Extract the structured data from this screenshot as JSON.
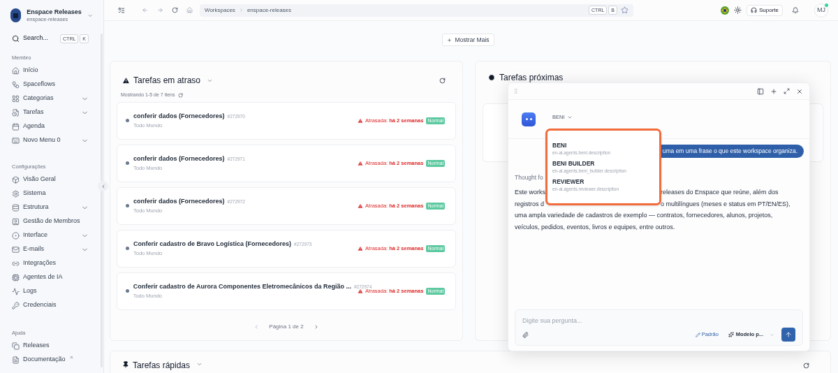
{
  "workspace": {
    "name": "Enspace Releases",
    "slug": "enspace-releases"
  },
  "search": {
    "label": "Search...",
    "keys": [
      "CTRL",
      "K"
    ]
  },
  "sidebar": {
    "sections": [
      {
        "title": "Membro",
        "items": [
          {
            "label": "Início",
            "expandable": false,
            "external": false
          },
          {
            "label": "Spaceflows",
            "expandable": false,
            "external": false
          },
          {
            "label": "Categorias",
            "expandable": true,
            "external": false
          },
          {
            "label": "Tarefas",
            "expandable": true,
            "external": false
          },
          {
            "label": "Agenda",
            "expandable": false,
            "external": false
          },
          {
            "label": "Novo Menu 0",
            "expandable": true,
            "external": false
          }
        ]
      },
      {
        "title": "Configurações",
        "items": [
          {
            "label": "Visão Geral",
            "expandable": false,
            "external": false
          },
          {
            "label": "Sistema",
            "expandable": false,
            "external": false
          },
          {
            "label": "Estrutura",
            "expandable": true,
            "external": false
          },
          {
            "label": "Gestão de Membros",
            "expandable": false,
            "external": false
          },
          {
            "label": "Interface",
            "expandable": true,
            "external": false
          },
          {
            "label": "E-mails",
            "expandable": true,
            "external": false
          },
          {
            "label": "Integrações",
            "expandable": false,
            "external": false
          },
          {
            "label": "Agentes de IA",
            "expandable": false,
            "external": false
          },
          {
            "label": "Logs",
            "expandable": false,
            "external": false
          },
          {
            "label": "Credenciais",
            "expandable": false,
            "external": false
          }
        ]
      },
      {
        "title": "Ajuda",
        "items": [
          {
            "label": "Releases",
            "expandable": false,
            "external": false
          },
          {
            "label": "Documentação",
            "expandable": false,
            "external": true
          }
        ]
      }
    ]
  },
  "toolbar": {
    "breadcrumb": [
      "Workspaces",
      "enspace-releases"
    ],
    "keys": [
      "CTRL",
      "B"
    ],
    "support": "Suporte",
    "avatar": "MJ",
    "online": true
  },
  "show_more": "Mostrar Mais",
  "overdue": {
    "title": "Tarefas em atraso",
    "summary": "Mostrando 1-5 de 7 itens",
    "pagination": "Página 1 de 2",
    "tasks": [
      {
        "title": "conferir dados (Fornecedores)",
        "id": "#272970",
        "assignee": "Todo Mundo",
        "due": "Atrasada: **há 2 semanas**",
        "priority": "Normal"
      },
      {
        "title": "conferir dados (Fornecedores)",
        "id": "#272971",
        "assignee": "Todo Mundo",
        "due": "Atrasada: **há 2 semanas**",
        "priority": "Normal"
      },
      {
        "title": "conferir dados (Fornecedores)",
        "id": "#272972",
        "assignee": "Todo Mundo",
        "due": "Atrasada: **há 2 semanas**",
        "priority": "Normal"
      },
      {
        "title": "Conferir cadastro de Bravo Logística (Fornecedores)",
        "id": "#272973",
        "assignee": "Todo Mundo",
        "due": "Atrasada: **há 2 semanas**",
        "priority": "Normal"
      },
      {
        "title": "Conferir cadastro de Aurora Componentes Eletromecânicos da Região ...",
        "id": "#272974",
        "assignee": "Todo Mundo",
        "due": "Atrasada: **há 2 semanas**",
        "priority": "Normal"
      }
    ]
  },
  "upcoming": {
    "title": "Tarefas próximas"
  },
  "quick": {
    "title": "Tarefas rápidas"
  },
  "chat": {
    "agent": "BENI",
    "agents": [
      {
        "name": "BENI",
        "description": "en-ai.agents.beni.description"
      },
      {
        "name": "BENI BUILDER",
        "description": "en-ai.agents.beni_builder.description"
      },
      {
        "name": "REVIEWER",
        "description": "en-ai.agents.reviewer.description"
      }
    ],
    "user_message": "uma em uma frase o que este workspace organiza.",
    "thought": "Thought fo",
    "answer_lines": [
      [
        "Este works",
        "releases do Enspace que reúne, além dos"
      ],
      [
        "registros d",
        "o multilíngues (meses e status em PT/EN/ES),"
      ],
      [
        "uma ampla variedade de cadastros de exemplo — contratos, fornecedores, alunos, projetos,"
      ],
      [
        "veículos, pedidos, eventos, livros e equipes, entre outros."
      ]
    ],
    "placeholder": "Digite sua pergunta...",
    "mode": "Padrão",
    "model": "Modelo p..."
  }
}
